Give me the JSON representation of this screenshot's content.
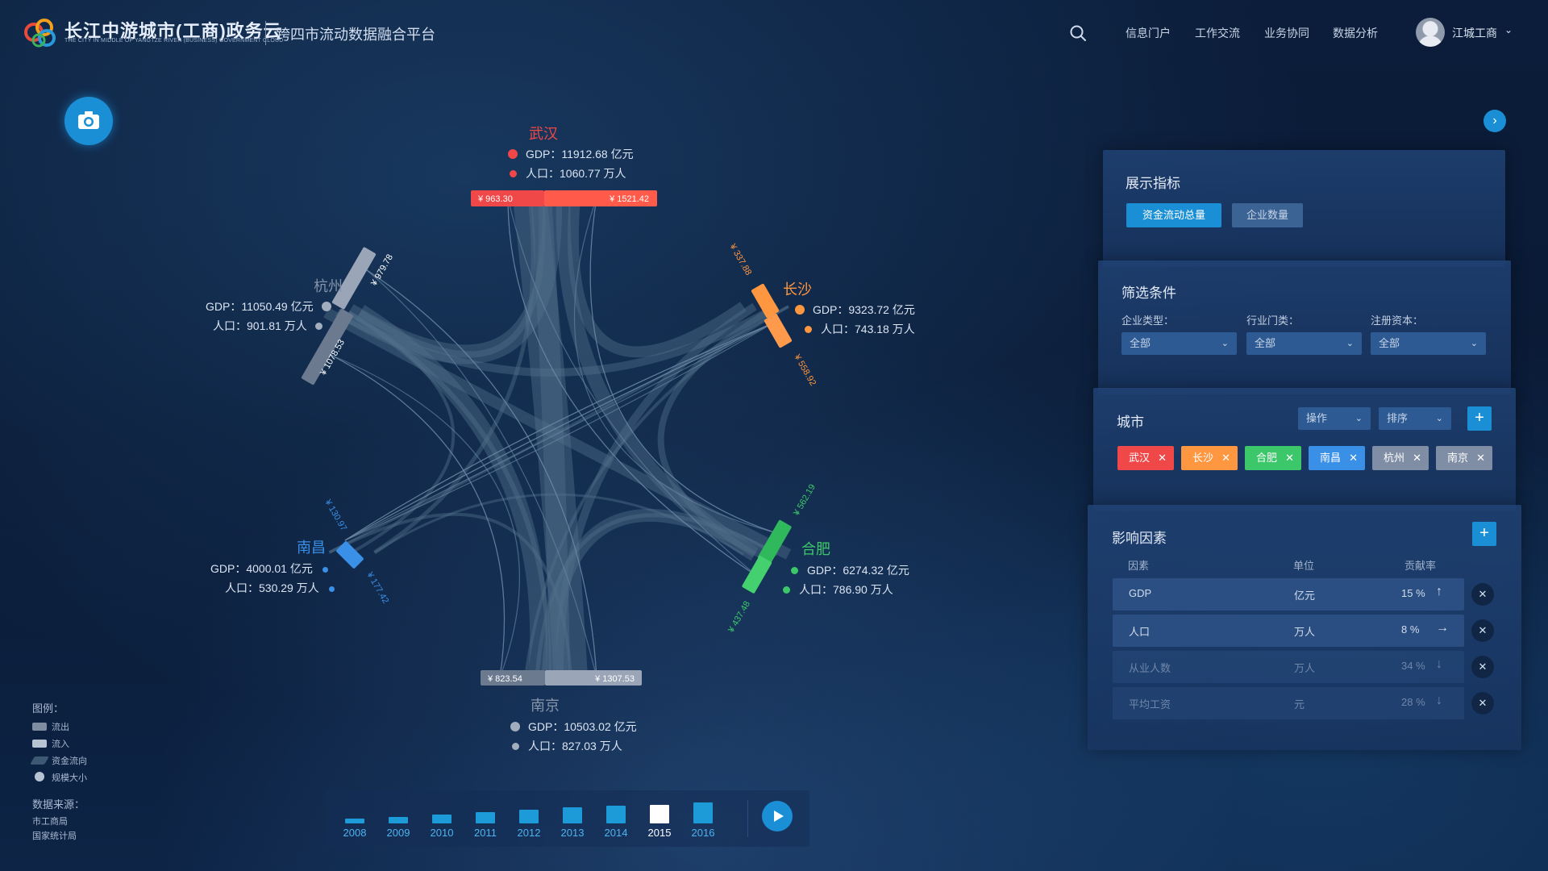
{
  "header": {
    "brand_cn": "长江中游城市(工商)政务云",
    "brand_en": "THE CITY IN MIDDLE OF YANGTZE RIVER (BUSINESS) GOVERNMENT CLOUD",
    "platform": "跨四市流动数据融合平台",
    "search_icon": "search-icon",
    "nav": [
      "信息门户",
      "工作交流",
      "业务协同",
      "数据分析"
    ],
    "user": "江城工商"
  },
  "colors": {
    "wuhan": "#f04848",
    "changsha": "#ff9640",
    "hefei": "#3cc86a",
    "nanchang": "#3a8fe6",
    "hangzhou": "#8e9cb2",
    "nanjing": "#8e9cb2",
    "accent": "#1a8fd6"
  },
  "cities": {
    "wuhan": {
      "name": "武汉",
      "gdp": "GDP：11912.68 亿元",
      "pop": "人口：1060.77 万人",
      "out": "¥ 963.30",
      "in": "¥ 1521.42"
    },
    "changsha": {
      "name": "长沙",
      "gdp": "GDP：9323.72 亿元",
      "pop": "人口：743.18 万人",
      "out": "¥ 337.88",
      "in": "¥ 558.92"
    },
    "hefei": {
      "name": "合肥",
      "gdp": "GDP：6274.32 亿元",
      "pop": "人口：786.90 万人",
      "out": "¥ 562.19",
      "in": "¥ 437.48"
    },
    "nanjing": {
      "name": "南京",
      "gdp": "GDP：10503.02 亿元",
      "pop": "人口：827.03 万人",
      "out": "¥ 823.54",
      "in": "¥ 1307.53"
    },
    "nanchang": {
      "name": "南昌",
      "gdp": "GDP：4000.01 亿元",
      "pop": "人口：530.29 万人",
      "out": "¥ 130.97",
      "in": "¥ 177.42"
    },
    "hangzhou": {
      "name": "杭州",
      "gdp": "GDP：11050.49 亿元",
      "pop": "人口：901.81 万人",
      "out": "¥ 979.78",
      "in": "¥ 1078.53"
    }
  },
  "legend": {
    "title": "图例：",
    "items": [
      "流出",
      "流入",
      "资金流向",
      "规模大小"
    ],
    "source_title": "数据来源：",
    "sources": [
      "市工商局",
      "国家统计局"
    ]
  },
  "timeline": {
    "years": [
      "2008",
      "2009",
      "2010",
      "2011",
      "2012",
      "2013",
      "2014",
      "2015",
      "2016"
    ],
    "levels": [
      0.22,
      0.3,
      0.38,
      0.5,
      0.6,
      0.7,
      0.8,
      0.82,
      0.92
    ],
    "active": "2015"
  },
  "panel_metrics": {
    "title": "展示指标",
    "btn_primary": "资金流动总量",
    "btn_secondary": "企业数量"
  },
  "panel_filter": {
    "title": "筛选条件",
    "labels": [
      "企业类型：",
      "行业门类：",
      "注册资本："
    ],
    "values": [
      "全部",
      "全部",
      "全部"
    ]
  },
  "panel_city": {
    "title": "城市",
    "op": "操作",
    "sort": "排序",
    "tags": [
      "武汉",
      "长沙",
      "合肥",
      "南昌",
      "杭州",
      "南京"
    ],
    "tag_colors": [
      "#f04848",
      "#ff9640",
      "#3cc86a",
      "#3a8fe6",
      "#7f8ea4",
      "#7f8ea4"
    ]
  },
  "panel_factor": {
    "title": "影响因素",
    "headers": [
      "因素",
      "单位",
      "贡献率"
    ],
    "rows": [
      {
        "name": "GDP",
        "unit": "亿元",
        "rate": "15 %",
        "arrow": "↑"
      },
      {
        "name": "人口",
        "unit": "万人",
        "rate": "8 %",
        "arrow": "→"
      },
      {
        "name": "从业人数",
        "unit": "万人",
        "rate": "34 %",
        "arrow": "↓"
      },
      {
        "name": "平均工资",
        "unit": "元",
        "rate": "28 %",
        "arrow": "↓"
      }
    ]
  }
}
